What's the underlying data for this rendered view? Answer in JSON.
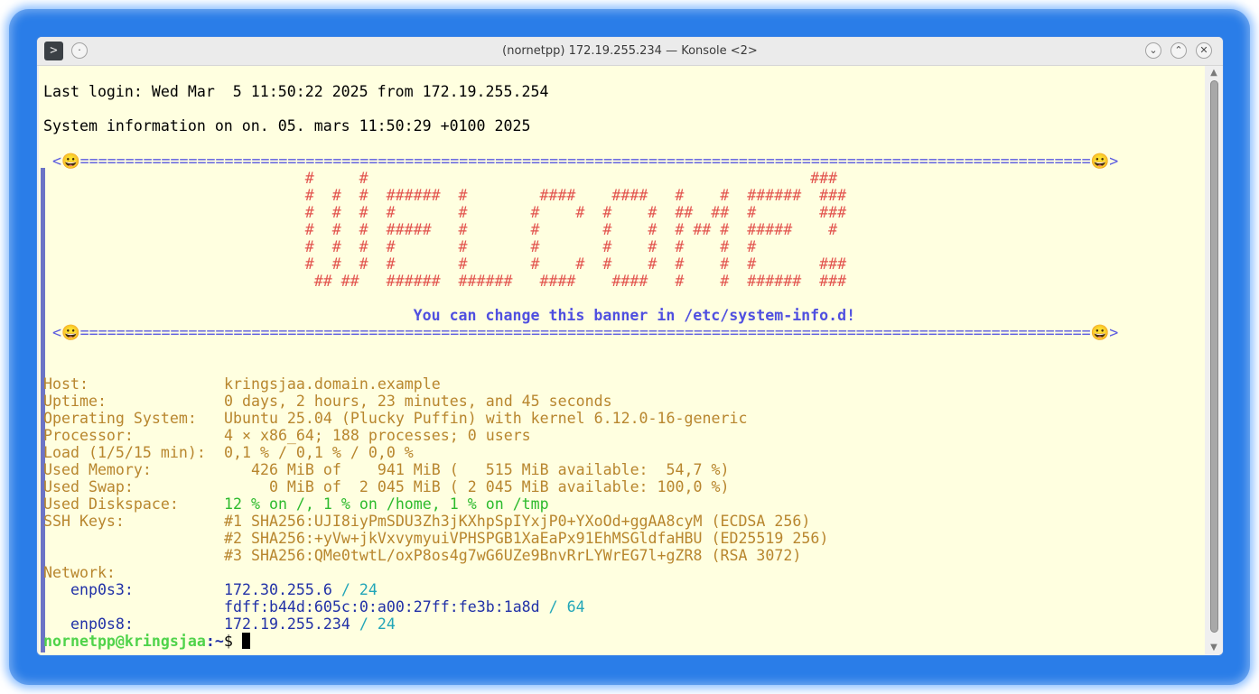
{
  "window": {
    "title": "(nornetpp) 172.19.255.234 — Konsole <2>",
    "app_icon": ">",
    "buttons": {
      "minimize": "⌄",
      "maximize": "⌃",
      "close": "✕"
    }
  },
  "terminal": {
    "last_login": "Last login: Wed Mar  5 11:50:22 2025 from 172.19.255.254",
    "sysinfo_header": "System information on on. 05. mars 11:50:29 +0100 2025",
    "banner": {
      "border_top": " <😀================================================================================================================😀>",
      "art": [
        "                             #     #                                                 ###",
        "                             #  #  #  ######  #        ####    ####   #    #  ######  ###",
        "                             #  #  #  #       #       #    #  #    #  ##  ##  #       ###",
        "                             #  #  #  #####   #       #       #    #  # ## #  #####    #",
        "                             #  #  #  #       #       #       #    #  #    #  #",
        "                             #  #  #  #       #       #    #  #    #  #    #  #       ###",
        "                              ## ##   ######  ######   ####    ####   #    #  ######  ###"
      ],
      "message": "                                         You can change this banner in /etc/system-info.d!",
      "border_bottom": " <😀================================================================================================================😀>"
    },
    "info": {
      "host_label": "Host:",
      "host_value": "kringsjaa.domain.example",
      "uptime_label": "Uptime:",
      "uptime_value": "0 days, 2 hours, 23 minutes, and 45 seconds",
      "os_label": "Operating System:",
      "os_value": "Ubuntu 25.04 (Plucky Puffin) with kernel 6.12.0-16-generic",
      "processor_label": "Processor:",
      "processor_value": "4 × x86_64; 188 processes; 0 users",
      "load_label": "Load (1/5/15 min):",
      "load_value": "0,1 % / 0,1 % / 0,0 %",
      "memory_label": "Used Memory:",
      "memory_value": "   426 MiB of    941 MiB (   515 MiB available:  54,7 %)",
      "swap_label": "Used Swap:",
      "swap_value": "     0 MiB of  2 045 MiB ( 2 045 MiB available: 100,0 %)",
      "disk_label": "Used Diskspace:",
      "disk_value": "12 % on /, 1 % on /home, 1 % on /tmp",
      "ssh_label": "SSH Keys:",
      "ssh_keys": [
        "#1 SHA256:UJI8iyPmSDU3Zh3jKXhpSpIYxjP0+YXoOd+ggAA8cyM (ECDSA 256)",
        "#2 SHA256:+yVw+jkVxvymyuiVPHSPGB1XaEaPx91EhMSGldfaHBU (ED25519 256)",
        "#3 SHA256:QMe0twtL/oxP8os4g7wG6UZe9BnvRrLYWrEG7l+gZR8 (RSA 3072)"
      ],
      "network_label": "Network:",
      "interfaces": [
        {
          "name": "   enp0s3:",
          "addr": "172.30.255.6",
          "prefix": " / 24"
        },
        {
          "name": "",
          "addr": "fdff:b44d:605c:0:a00:27ff:fe3b:1a8d",
          "prefix": " / 64"
        },
        {
          "name": "   enp0s8:",
          "addr": "172.19.255.234",
          "prefix": " / 24"
        }
      ]
    },
    "prompt": {
      "user": "nornetpp@kringsjaa",
      "path": ":~",
      "symbol": "$ "
    }
  },
  "colors": {
    "background": "#ffffe0",
    "banner_border": "#5a5ae0",
    "art": "#e2544e",
    "info": "#b8862e",
    "disk": "#2cba2c",
    "address": "#2131a7",
    "prefix": "#22a6b8",
    "prompt_user": "#4fd34a"
  }
}
